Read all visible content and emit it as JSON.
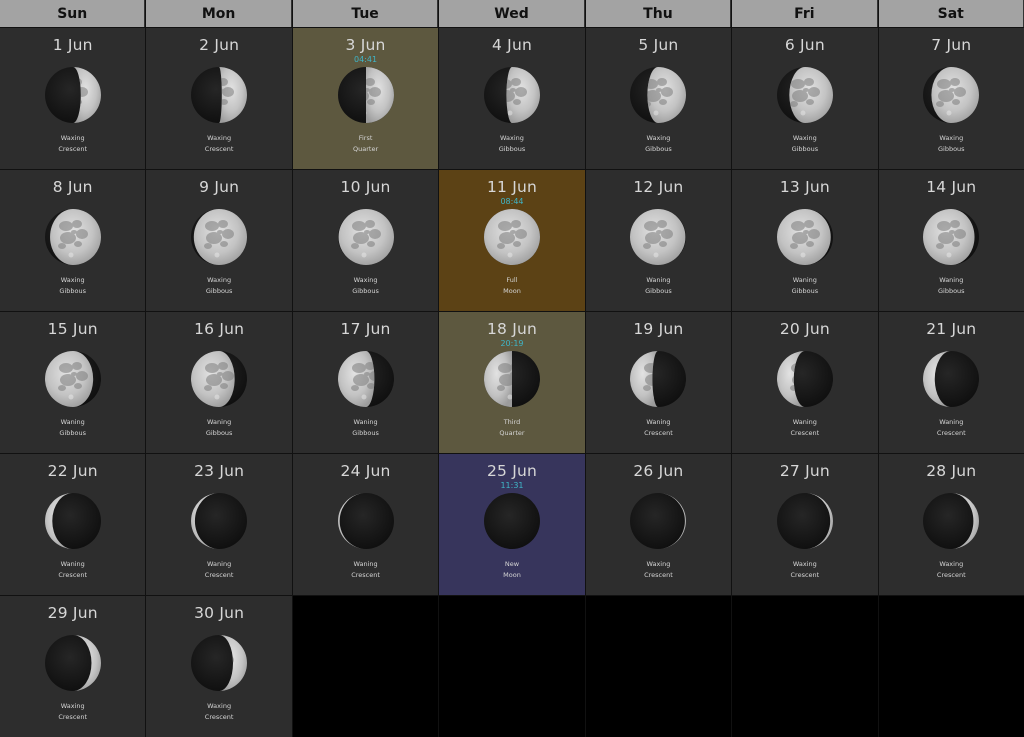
{
  "weekdays": [
    "Sun",
    "Mon",
    "Tue",
    "Wed",
    "Thu",
    "Fri",
    "Sat"
  ],
  "leading_blank_days": 0,
  "days": [
    {
      "label": "1 Jun",
      "phase1": "Waxing",
      "phase2": "Crescent",
      "illum": 0.36,
      "waxing": true
    },
    {
      "label": "2 Jun",
      "phase1": "Waxing",
      "phase2": "Crescent",
      "illum": 0.45,
      "waxing": true
    },
    {
      "label": "3 Jun",
      "phase1": "First",
      "phase2": "Quarter",
      "illum": 0.5,
      "waxing": true,
      "time": "04:41",
      "highlight": "hl-first"
    },
    {
      "label": "4 Jun",
      "phase1": "Waxing",
      "phase2": "Gibbous",
      "illum": 0.6,
      "waxing": true
    },
    {
      "label": "5 Jun",
      "phase1": "Waxing",
      "phase2": "Gibbous",
      "illum": 0.69,
      "waxing": true
    },
    {
      "label": "6 Jun",
      "phase1": "Waxing",
      "phase2": "Gibbous",
      "illum": 0.78,
      "waxing": true
    },
    {
      "label": "7 Jun",
      "phase1": "Waxing",
      "phase2": "Gibbous",
      "illum": 0.85,
      "waxing": true
    },
    {
      "label": "8 Jun",
      "phase1": "Waxing",
      "phase2": "Gibbous",
      "illum": 0.91,
      "waxing": true
    },
    {
      "label": "9 Jun",
      "phase1": "Waxing",
      "phase2": "Gibbous",
      "illum": 0.95,
      "waxing": true
    },
    {
      "label": "10 Jun",
      "phase1": "Waxing",
      "phase2": "Gibbous",
      "illum": 0.99,
      "waxing": true
    },
    {
      "label": "11 Jun",
      "phase1": "Full",
      "phase2": "Moon",
      "illum": 1.0,
      "waxing": true,
      "time": "08:44",
      "highlight": "hl-full"
    },
    {
      "label": "12 Jun",
      "phase1": "Waning",
      "phase2": "Gibbous",
      "illum": 0.99,
      "waxing": false
    },
    {
      "label": "13 Jun",
      "phase1": "Waning",
      "phase2": "Gibbous",
      "illum": 0.96,
      "waxing": false
    },
    {
      "label": "14 Jun",
      "phase1": "Waning",
      "phase2": "Gibbous",
      "illum": 0.92,
      "waxing": false
    },
    {
      "label": "15 Jun",
      "phase1": "Waning",
      "phase2": "Gibbous",
      "illum": 0.86,
      "waxing": false
    },
    {
      "label": "16 Jun",
      "phase1": "Waning",
      "phase2": "Gibbous",
      "illum": 0.78,
      "waxing": false
    },
    {
      "label": "17 Jun",
      "phase1": "Waning",
      "phase2": "Gibbous",
      "illum": 0.65,
      "waxing": false
    },
    {
      "label": "18 Jun",
      "phase1": "Third",
      "phase2": "Quarter",
      "illum": 0.5,
      "waxing": false,
      "time": "20:19",
      "highlight": "hl-third"
    },
    {
      "label": "19 Jun",
      "phase1": "Waning",
      "phase2": "Crescent",
      "illum": 0.4,
      "waxing": false
    },
    {
      "label": "20 Jun",
      "phase1": "Waning",
      "phase2": "Crescent",
      "illum": 0.3,
      "waxing": false
    },
    {
      "label": "21 Jun",
      "phase1": "Waning",
      "phase2": "Crescent",
      "illum": 0.21,
      "waxing": false
    },
    {
      "label": "22 Jun",
      "phase1": "Waning",
      "phase2": "Crescent",
      "illum": 0.13,
      "waxing": false
    },
    {
      "label": "23 Jun",
      "phase1": "Waning",
      "phase2": "Crescent",
      "illum": 0.07,
      "waxing": false
    },
    {
      "label": "24 Jun",
      "phase1": "Waning",
      "phase2": "Crescent",
      "illum": 0.03,
      "waxing": false
    },
    {
      "label": "25 Jun",
      "phase1": "New",
      "phase2": "Moon",
      "illum": 0.0,
      "waxing": true,
      "time": "11:31",
      "highlight": "hl-new"
    },
    {
      "label": "26 Jun",
      "phase1": "Waxing",
      "phase2": "Crescent",
      "illum": 0.02,
      "waxing": true
    },
    {
      "label": "27 Jun",
      "phase1": "Waxing",
      "phase2": "Crescent",
      "illum": 0.05,
      "waxing": true
    },
    {
      "label": "28 Jun",
      "phase1": "Waxing",
      "phase2": "Crescent",
      "illum": 0.1,
      "waxing": true
    },
    {
      "label": "29 Jun",
      "phase1": "Waxing",
      "phase2": "Crescent",
      "illum": 0.17,
      "waxing": true
    },
    {
      "label": "30 Jun",
      "phase1": "Waxing",
      "phase2": "Crescent",
      "illum": 0.25,
      "waxing": true
    }
  ],
  "colors": {
    "header_bg": "#a3a3a3",
    "cell_bg": "#2d2d2d",
    "quarter_highlight": "#5d583f",
    "full_highlight": "#5c4215",
    "new_highlight": "#37355c",
    "time_text": "#3fb5c7",
    "moon_lit": "#c8c8c8",
    "moon_dark": "#141414"
  }
}
